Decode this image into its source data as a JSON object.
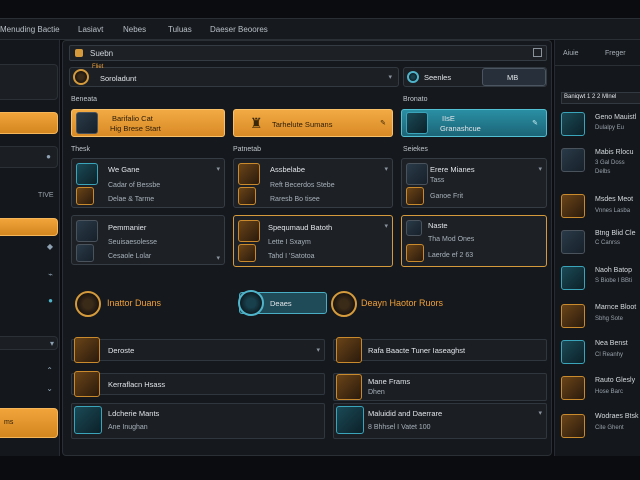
{
  "topbar": {
    "tabs": [
      "Menuding Bactie",
      "Lasiavt",
      "Nebes",
      "Tuluas",
      "Daeser Beoores"
    ]
  },
  "leftpanel": {
    "labels": [
      "TIVE"
    ],
    "glyphs": [
      "●",
      "◆",
      "⌁",
      "●",
      "⌃",
      "⌄",
      "▾"
    ],
    "bottom_label": "ms"
  },
  "main": {
    "search_label": "Suebn",
    "filter": {
      "tag": "Fliet",
      "value": "Soroladunt"
    },
    "toggle": {
      "label": "Seenles",
      "value": "MB"
    },
    "sections": {
      "left": "Beneata",
      "right": "Bronato",
      "col1": "Thesk",
      "col2": "Patnetab",
      "col3": "Seiekes"
    },
    "top_cards": [
      {
        "title": "Barifalio Cat",
        "subtitle": "Hig Brese Start"
      },
      {
        "title": "Tarhelute Sumans",
        "subtitle": ""
      },
      {
        "title": "IIsE",
        "subtitle": "Granashcue"
      }
    ],
    "grid_cards": [
      {
        "title": "We Gane",
        "line2": "Cadar of Bessbe",
        "line3": "Delae  &  Tarme"
      },
      {
        "title": "Assbelabe",
        "line2": "Reft  Becerdos Stebe",
        "line3": "Raresb  Bo  tisee"
      },
      {
        "title": "Erere Mianes",
        "line2": "Tass",
        "line3": "Ganoe Frit"
      },
      {
        "title": "Pemmanier",
        "line2": "Seuisaesolesse",
        "line3": "Cesaole Lolar"
      },
      {
        "title": "Spequmaud Batoth",
        "line2": "Lette  I  Sxaym",
        "line3": "Tahd  I  'Satotoa"
      },
      {
        "title": "Naste",
        "line2": "Tha Mod Ones",
        "line3": "Laerde  ef  2  63"
      }
    ],
    "banners": [
      "Inattor Duans",
      "Deaes",
      "Deayn Haotor Ruors"
    ],
    "list_rows": [
      {
        "title": "Deroste",
        "subtitle": ""
      },
      {
        "title": "Rafa Baacte Tuner Iaseaghst",
        "subtitle": ""
      },
      {
        "title": "Kerraflacn Hsass",
        "subtitle": ""
      },
      {
        "title": "Mane Frams",
        "subtitle": "Dhen"
      },
      {
        "title": "Ldcherie Mants",
        "subtitle": "Ane Inughan"
      },
      {
        "title": "Maluidid and Daerrare",
        "subtitle": "8 Bhhsel I Vatet 100"
      }
    ]
  },
  "rightpanel": {
    "header": [
      "Aiuie",
      "Freger"
    ],
    "tag": "Baniqwt  1 2 2   Mlnel",
    "items": [
      {
        "title": "Geno  Mauistl",
        "sub": "Dulalpy  Eu",
        "sub2": ""
      },
      {
        "title": "Mabis  Rlocu",
        "sub": "3 Gal Doss",
        "sub2": "Delbs"
      },
      {
        "title": "Msdes  Meot",
        "sub": "Vnnes  Lasba",
        "sub2": ""
      },
      {
        "title": "Btng  Blid  Cle",
        "sub": "C  Canrss",
        "sub2": ""
      },
      {
        "title": "Naoh  Batop",
        "sub": "S  Biobe  I  BBti",
        "sub2": ""
      },
      {
        "title": "Marnce  Bloot",
        "sub": "Sbhg  Sote",
        "sub2": ""
      },
      {
        "title": "Nea  Benst",
        "sub": "Cl  Reanhy",
        "sub2": ""
      },
      {
        "title": "Rauto  Glesly",
        "sub": "Hose  Barc",
        "sub2": ""
      },
      {
        "title": "Wodraes  Btsk",
        "sub": "Cite  Ghent",
        "sub2": ""
      }
    ]
  }
}
